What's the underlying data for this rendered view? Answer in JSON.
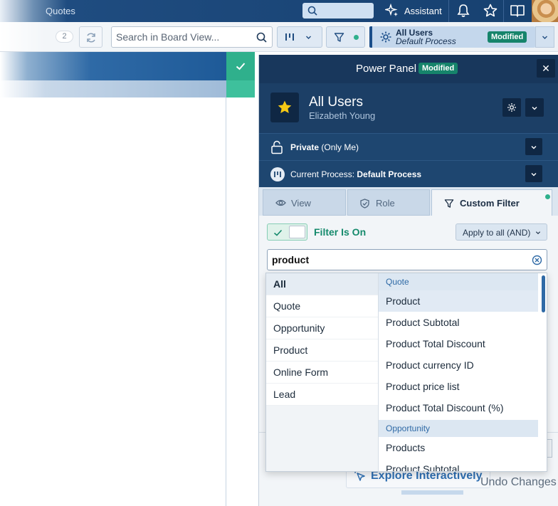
{
  "topbar": {
    "crumb": "Quotes",
    "assistant_label": "Assistant"
  },
  "toolbar": {
    "count": "2",
    "search_placeholder": "Search in Board View...",
    "process_title": "All Users",
    "process_subtitle": "Default Process",
    "process_badge": "Modified"
  },
  "power_panel": {
    "title": "Power Panel",
    "badge": "Modified",
    "close_glyph": "✕",
    "user_title": "All Users",
    "user_name": "Elizabeth Young",
    "privacy_bold": "Private",
    "privacy_rest": " (Only Me)",
    "process_prefix": "Current Process: ",
    "process_name": "Default Process",
    "tabs": [
      {
        "label": "View",
        "icon": "eye-icon"
      },
      {
        "label": "Role",
        "icon": "shield-icon"
      },
      {
        "label": "Custom Filter",
        "icon": "filter-icon"
      }
    ],
    "filter_status": "Filter Is On",
    "apply_label": "Apply to all (AND)",
    "search_value": "product"
  },
  "dropdown": {
    "categories": [
      "All",
      "Quote",
      "Opportunity",
      "Product",
      "Online Form",
      "Lead"
    ],
    "groups": [
      {
        "header": "Quote",
        "items": [
          "Product",
          "Product Subtotal",
          "Product Total Discount",
          "Product currency ID",
          "Product price list",
          "Product Total Discount (%)"
        ]
      },
      {
        "header": "Opportunity",
        "items": [
          "Products",
          "Product Subtotal"
        ]
      }
    ]
  },
  "behind": {
    "explore_label": "Explore Interactively",
    "undo_label": "Undo Changes"
  },
  "colors": {
    "navy": "#18375c",
    "accent_green": "#16846b",
    "link_blue": "#2f6aa6"
  }
}
